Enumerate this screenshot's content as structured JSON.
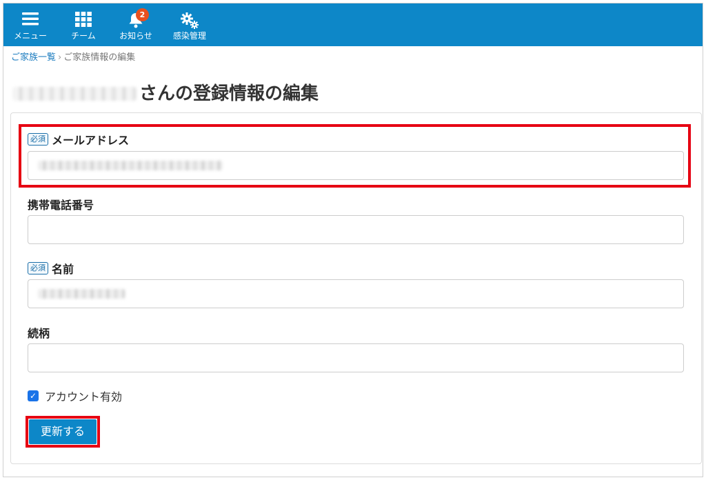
{
  "nav": {
    "menu_label": "メニュー",
    "team_label": "チーム",
    "notice_label": "お知らせ",
    "notice_badge": "2",
    "infection_label": "感染管理"
  },
  "breadcrumb": {
    "family_list": "ご家族一覧",
    "separator": "›",
    "current": "ご家族情報の編集"
  },
  "page": {
    "title": "さんの登録情報の編集"
  },
  "form": {
    "required_tag": "必須",
    "email_label": "メールアドレス",
    "phone_label": "携帯電話番号",
    "name_label": "名前",
    "relation_label": "続柄",
    "account_active_label": "アカウント有効",
    "account_active_checked": true,
    "submit_label": "更新する"
  },
  "colors": {
    "header_bg": "#0d87c8",
    "highlight": "#e60012",
    "badge": "#e8501e",
    "checkbox": "#1a73e8"
  },
  "icons": {
    "menu": "hamburger-icon",
    "team": "grid-icon",
    "notice": "bell-icon",
    "infection": "gears-icon"
  }
}
